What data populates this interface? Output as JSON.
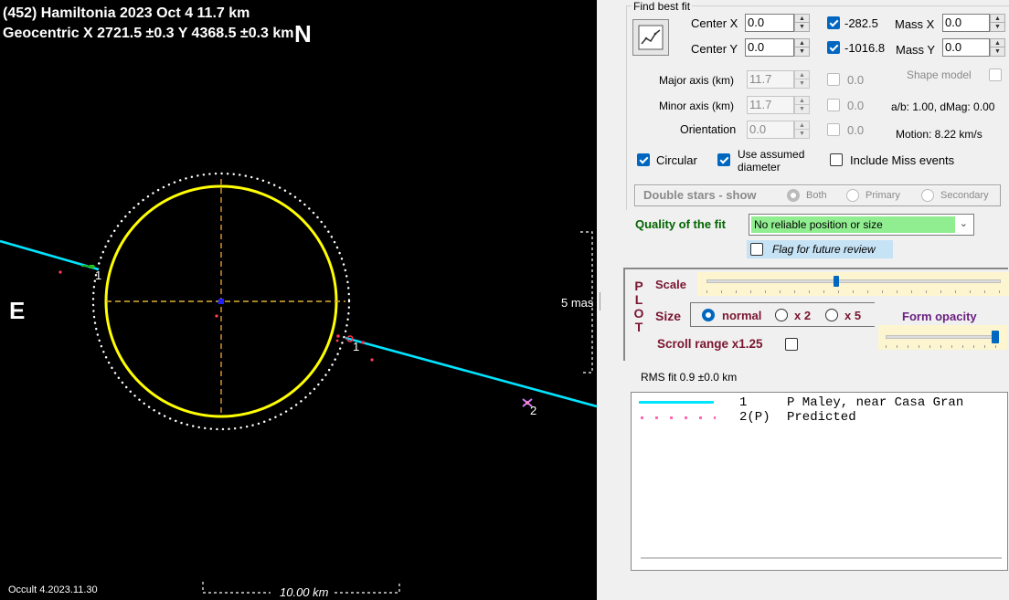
{
  "plot": {
    "title_line1": "(452) Hamiltonia  2023 Oct 4   11.7 km",
    "title_line2": "Geocentric  X  2721.5 ±0.3  Y 4368.5 ±0.3 km",
    "north_label": "N",
    "east_label": "E",
    "scale_label": "5 mas",
    "km_scale_label": "10.00 km",
    "version_label": "Occult 4.2023.11.30",
    "chord_label_1a": "1",
    "chord_label_1b": "1",
    "chord_label_2": "2"
  },
  "fit": {
    "group_title": "Find best fit",
    "center_x_label": "Center X",
    "center_x_value": "0.0",
    "center_x_result": "-282.5",
    "center_y_label": "Center Y",
    "center_y_value": "0.0",
    "center_y_result": "-1016.8",
    "mass_x_label": "Mass X",
    "mass_x_value": "0.0",
    "mass_y_label": "Mass Y",
    "mass_y_value": "0.0",
    "major_label": "Major axis (km)",
    "major_value": "11.7",
    "major_result": "0.0",
    "minor_label": "Minor axis (km)",
    "minor_value": "11.7",
    "minor_result": "0.0",
    "orient_label": "Orientation",
    "orient_value": "0.0",
    "orient_result": "0.0",
    "shape_model_label": "Shape model",
    "ab_text": "a/b: 1.00, dMag: 0.00",
    "motion_text": "Motion: 8.22 km/s",
    "circular_label": "Circular",
    "assumed_label_1": "Use assumed",
    "assumed_label_2": "diameter",
    "miss_label": "Include Miss events",
    "double_stars_label": "Double stars - show",
    "both_label": "Both",
    "primary_label": "Primary",
    "secondary_label": "Secondary",
    "quality_label": "Quality of the fit",
    "quality_value": "No reliable position or size",
    "flag_label": "Flag for future review"
  },
  "plotctl": {
    "side_letters": [
      "P",
      "L",
      "O",
      "T"
    ],
    "scale_label": "Scale",
    "scale_level": 0.44,
    "size_label": "Size",
    "normal_label": "normal",
    "x2_label": "x 2",
    "x5_label": "x 5",
    "form_opacity_label": "Form opacity",
    "opacity_level": 0.97,
    "scroll_range_label": "Scroll range x1.25"
  },
  "rms_text": "RMS fit 0.9 ±0.0 km",
  "legend": [
    {
      "num": "1",
      "text": "P Maley, near Casa Gran"
    },
    {
      "num": "2(P)",
      "text": "Predicted"
    }
  ],
  "colors": {
    "chord": "#00e5ff",
    "ellipse": "#ffff00",
    "axes": "#c8862a",
    "quality_bg": "#90ee90",
    "legend_pred": "#ff69b4"
  }
}
